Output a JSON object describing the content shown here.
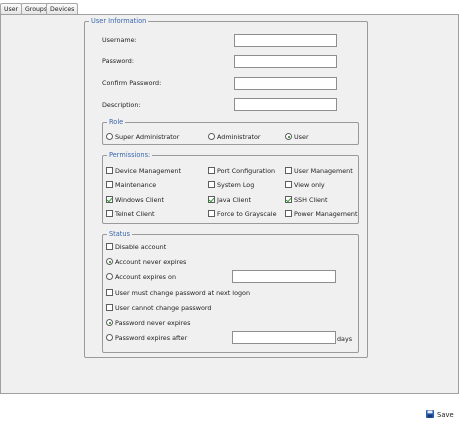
{
  "tabs": [
    {
      "label": "User",
      "active": true
    },
    {
      "label": "Groups",
      "active": false
    },
    {
      "label": "Devices",
      "active": false
    }
  ],
  "user_info": {
    "legend": "User Information",
    "fields": [
      {
        "label": "Username:",
        "value": ""
      },
      {
        "label": "Password:",
        "value": ""
      },
      {
        "label": "Confirm Password:",
        "value": ""
      },
      {
        "label": "Description:",
        "value": ""
      }
    ]
  },
  "role": {
    "legend": "Role",
    "options": [
      {
        "label": "Super Administrator",
        "selected": false
      },
      {
        "label": "Administrator",
        "selected": false
      },
      {
        "label": "User",
        "selected": true
      }
    ]
  },
  "permissions": {
    "legend": "Permissions:",
    "items": [
      {
        "label": "Device Management",
        "checked": false
      },
      {
        "label": "Port Configuration",
        "checked": false
      },
      {
        "label": "User Management",
        "checked": false
      },
      {
        "label": "Maintenance",
        "checked": false
      },
      {
        "label": "System Log",
        "checked": false
      },
      {
        "label": "View only",
        "checked": false
      },
      {
        "label": "Windows Client",
        "checked": true
      },
      {
        "label": "Java Client",
        "checked": true
      },
      {
        "label": "SSH Client",
        "checked": true
      },
      {
        "label": "Telnet Client",
        "checked": false
      },
      {
        "label": "Force to Grayscale",
        "checked": false
      },
      {
        "label": "Power Management",
        "checked": false
      }
    ]
  },
  "status": {
    "legend": "Status",
    "disable_account": {
      "label": "Disable account",
      "checked": false
    },
    "account_never_expires": {
      "label": "Account never expires",
      "selected": true
    },
    "account_expires_on": {
      "label": "Account expires on",
      "selected": false,
      "value": ""
    },
    "must_change_password": {
      "label": "User must change password at next logon",
      "checked": false
    },
    "cannot_change_password": {
      "label": "User cannot change password",
      "checked": false
    },
    "password_never_expires": {
      "label": "Password never expires",
      "selected": true
    },
    "password_expires_after": {
      "label": "Password expires after",
      "selected": false,
      "value": "",
      "unit": "days"
    }
  },
  "footer": {
    "save_label": "Save",
    "save_icon": "floppy-disk-icon"
  }
}
